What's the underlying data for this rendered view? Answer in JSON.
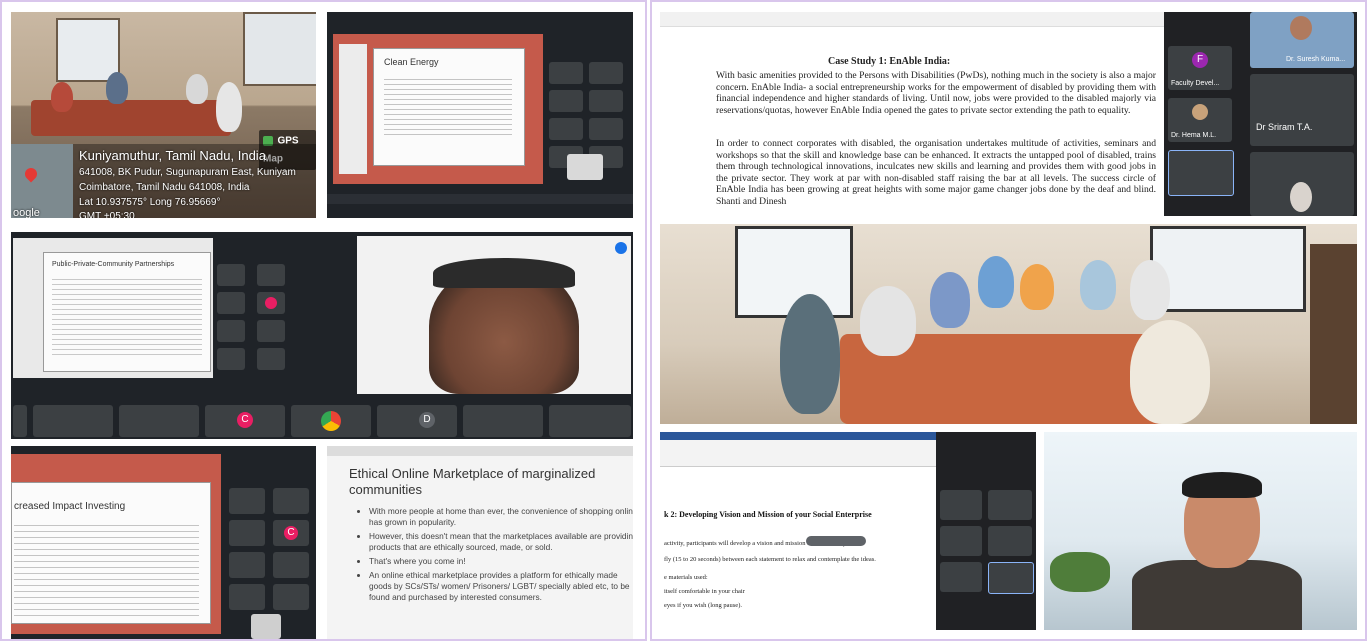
{
  "collage": {
    "photo1": {
      "gps_badge": "GPS Map",
      "place": "Kuniyamuthur, Tamil Nadu, India",
      "address1": "641008, BK Pudur, Sugunapuram East, Kuniyam",
      "address2": "Coimbatore, Tamil Nadu 641008, India",
      "coords": "Lat 10.937575° Long 76.95669°",
      "gmt": "GMT +05:30",
      "google": "oogle"
    },
    "meet1": {
      "slide_title": "Clean Energy",
      "colors": {
        "accent": "#c0392b"
      }
    },
    "meet2": {
      "slide_title": "Public-Private-Community Partnerships",
      "participant_letter": "C",
      "participant_letter2": "D"
    },
    "meet3": {
      "slide_title": "creased Impact Investing",
      "participant_letter": "C"
    },
    "slide4": {
      "title": "Ethical Online Marketplace of marginalized communities",
      "bullets": [
        "With more people at home than ever, the convenience of shopping online has grown in popularity.",
        "However, this doesn't mean that the marketplaces available are providing products that are ethically sourced, made, or sold.",
        "That's where you come in!",
        "An online ethical marketplace provides a platform for ethically made goods by SCs/STs/ women/ Prisoners/ LGBT/ specially abled etc, to be found and purchased by interested consumers."
      ]
    },
    "doc1": {
      "heading": "Case Study 1: EnAble India:",
      "para1": "With basic amenities provided to the Persons with Disabilities (PwDs), nothing much in the society is also a major concern. EnAble India- a social entrepreneurship works for the empowerment of disabled by providing them with financial independence and higher standards of living. Until now, jobs were provided to the disabled majorly via reservations/quotas, however EnAble India opened the gates to private sector extending the path to equality.",
      "para2": "In order to connect corporates with disabled, the organisation undertakes multitude of activities, seminars and workshops so that the skill and knowledge base can be enhanced. It extracts the untapped pool of disabled, trains them through technological innovations, inculcates new skills and learning and provides them with good jobs in the private sector. They work at par with non-disabled staff raising the bar at all levels. The success circle of EnAble India has been growing at great heights with some major game changer jobs done by the deaf and blind. Shanti and Dinesh",
      "participants": [
        "Dr. Suresh Kuma...",
        "Faculty Devel...",
        "Dr. Hema M.L.",
        "Dr Sriram T.A."
      ],
      "avatar_letter": "F"
    },
    "doc2": {
      "heading": "k 2: Developing Vision and Mission of your Social Enterprise",
      "line1": "activity, participants will develop a vision and mission for their enterprise.",
      "line2": "fly (15 to 20 seconds) between each statement to relax and contemplate the ideas.",
      "line3": "e materials used:",
      "line4": "itself comfortable in your chair",
      "line5": "eyes if you wish (long pause)."
    }
  }
}
